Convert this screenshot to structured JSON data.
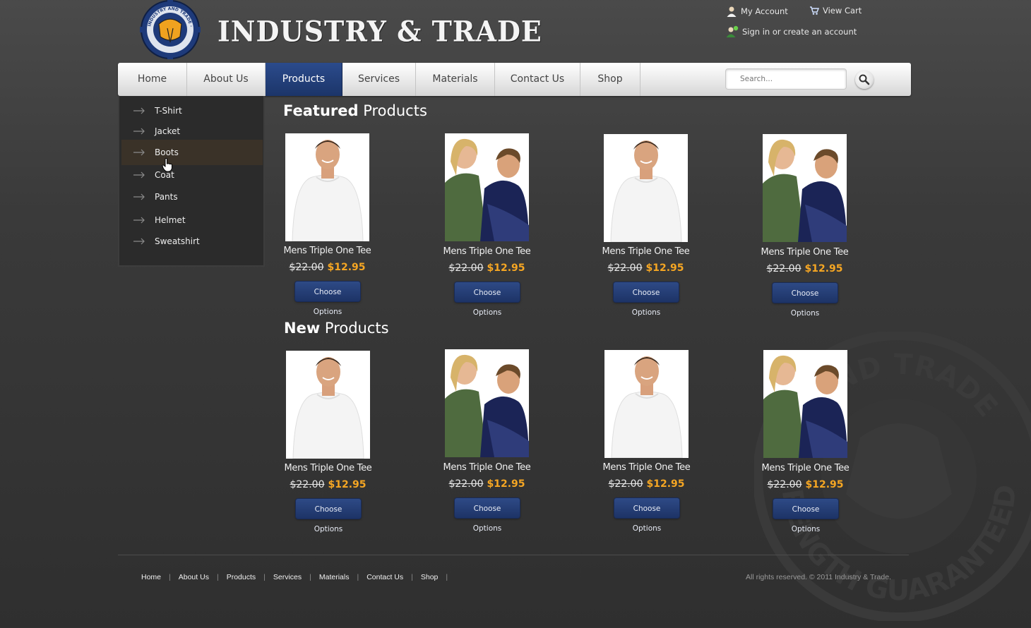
{
  "brand": {
    "name": "INDUSTRY & TRADE",
    "badge_text": "INDUSTRY AND TRADE · STRENGTH GUARANTEED"
  },
  "toplinks": {
    "account": "My Account",
    "cart": "View Cart",
    "signin": "Sign in or create an account"
  },
  "nav": {
    "items": [
      "Home",
      "About Us",
      "Products",
      "Services",
      "Materials",
      "Contact Us",
      "Shop"
    ],
    "active": "Products",
    "search_placeholder": "Search..."
  },
  "sidebar": {
    "items": [
      "T-Shirt",
      "Jacket",
      "Boots",
      "Coat",
      "Pants",
      "Helmet",
      "Sweatshirt"
    ],
    "hovered": "Boots"
  },
  "featured": {
    "title_bold": "Featured",
    "title_light": "Products",
    "products": [
      {
        "name": "Mens Triple One Tee",
        "old_price": "$22.00",
        "price": "$12.95",
        "button": "Choose Options",
        "image": "man-white-shirt"
      },
      {
        "name": "Mens Triple One Tee",
        "old_price": "$22.00",
        "price": "$12.95",
        "button": "Choose Options",
        "image": "couple"
      },
      {
        "name": "Mens Triple One Tee",
        "old_price": "$22.00",
        "price": "$12.95",
        "button": "Choose Options",
        "image": "man-white-shirt"
      },
      {
        "name": "Mens Triple One Tee",
        "old_price": "$22.00",
        "price": "$12.95",
        "button": "Choose Options",
        "image": "couple"
      }
    ]
  },
  "new_products": {
    "title_bold": "New",
    "title_light": "Products",
    "products": [
      {
        "name": "Mens Triple One Tee",
        "old_price": "$22.00",
        "price": "$12.95",
        "button": "Choose Options",
        "image": "man-white-shirt"
      },
      {
        "name": "Mens Triple One Tee",
        "old_price": "$22.00",
        "price": "$12.95",
        "button": "Choose Options",
        "image": "couple"
      },
      {
        "name": "Mens Triple One Tee",
        "old_price": "$22.00",
        "price": "$12.95",
        "button": "Choose Options",
        "image": "man-white-shirt"
      },
      {
        "name": "Mens Triple One Tee",
        "old_price": "$22.00",
        "price": "$12.95",
        "button": "Choose Options",
        "image": "couple"
      }
    ]
  },
  "footer": {
    "links": [
      "Home",
      "About Us",
      "Products",
      "Services",
      "Materials",
      "Contact Us",
      "Shop"
    ],
    "copyright": "All rights reserved. © 2011 Industry & Trade."
  },
  "watermark": {
    "top_text": "RY AND TRADE",
    "bottom_text": "RENGTH GUARANTEED"
  },
  "colors": {
    "accent": "#1d3366",
    "price": "#f5a623",
    "nav_active": "#2b4b8c"
  }
}
